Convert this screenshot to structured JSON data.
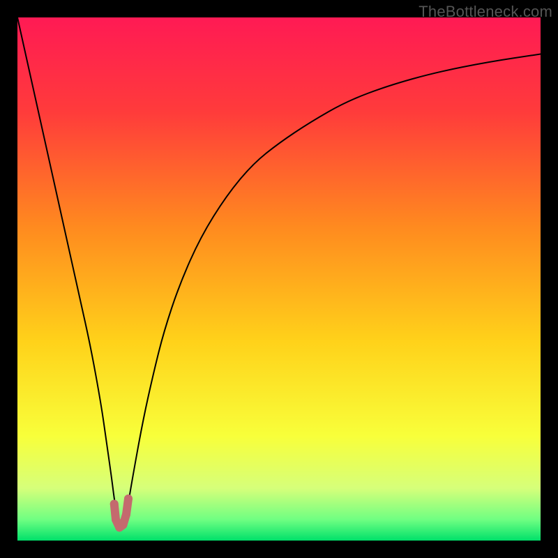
{
  "watermark": "TheBottleneck.com",
  "chart_data": {
    "type": "line",
    "title": "",
    "subtitle": "",
    "xlabel": "",
    "ylabel": "",
    "xlim": [
      0,
      100
    ],
    "ylim": [
      0,
      100
    ],
    "grid": false,
    "legend": false,
    "annotations": [],
    "background_gradient": {
      "orientation": "vertical",
      "stops": [
        {
          "offset": 0.0,
          "color": "#ff1a54"
        },
        {
          "offset": 0.18,
          "color": "#ff3b3b"
        },
        {
          "offset": 0.4,
          "color": "#ff8a1f"
        },
        {
          "offset": 0.62,
          "color": "#ffd21a"
        },
        {
          "offset": 0.8,
          "color": "#f8ff3a"
        },
        {
          "offset": 0.9,
          "color": "#d6ff7a"
        },
        {
          "offset": 0.96,
          "color": "#6fff82"
        },
        {
          "offset": 1.0,
          "color": "#00e06a"
        }
      ]
    },
    "series": [
      {
        "name": "bottleneck-curve",
        "color": "#000000",
        "stroke_width": 2,
        "x": [
          0,
          2,
          4,
          6,
          8,
          10,
          12,
          14,
          16,
          17,
          18,
          18.5,
          19,
          19.5,
          20,
          20.5,
          21,
          22,
          24,
          26,
          28,
          31,
          35,
          40,
          45,
          50,
          56,
          63,
          71,
          80,
          90,
          100
        ],
        "y": [
          100,
          91,
          82,
          73,
          64,
          55,
          46,
          37,
          26,
          19,
          12,
          8,
          5,
          3,
          3,
          4,
          6,
          12,
          23,
          32,
          40,
          49,
          58,
          66,
          72,
          76,
          80,
          84,
          87,
          89.5,
          91.5,
          93
        ]
      }
    ],
    "minimum_marker": {
      "color": "#c46a6e",
      "radius": 6,
      "points": [
        {
          "x": 18.5,
          "y": 7
        },
        {
          "x": 18.8,
          "y": 4
        },
        {
          "x": 19.5,
          "y": 2.5
        },
        {
          "x": 20.2,
          "y": 3
        },
        {
          "x": 20.8,
          "y": 5
        },
        {
          "x": 21.2,
          "y": 8
        }
      ]
    }
  }
}
